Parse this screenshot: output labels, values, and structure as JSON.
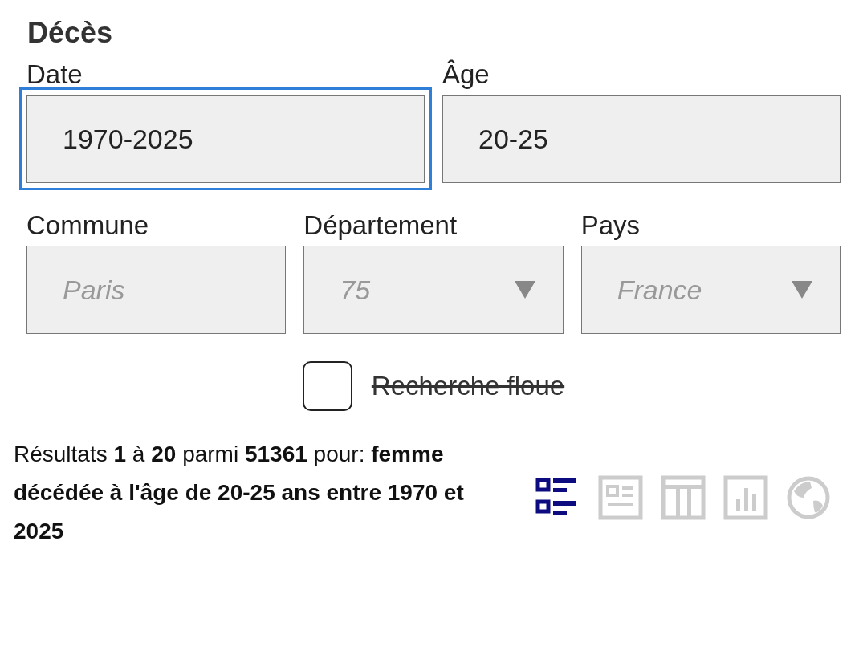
{
  "section": {
    "title": "Décès"
  },
  "rows": [
    [
      {
        "label": "Date",
        "kind": "text",
        "value": "1970-2025",
        "focused": true
      },
      {
        "label": "Âge",
        "kind": "text",
        "value": "20-25",
        "focused": false
      }
    ],
    [
      {
        "label": "Commune",
        "kind": "text",
        "placeholder": "Paris",
        "focused": false
      },
      {
        "label": "Département",
        "kind": "select",
        "placeholder": "75",
        "focused": false
      },
      {
        "label": "Pays",
        "kind": "select",
        "placeholder": "France",
        "focused": false
      }
    ]
  ],
  "fuzzy": {
    "label": "Recherche floue",
    "checked": false
  },
  "summary": "Résultats **1** à **20** parmi **51361** pour: **femme décédée à l'âge de 20-25 ans entre 1970 et 2025**",
  "views": [
    {
      "kind": "list",
      "selected": true
    },
    {
      "kind": "card",
      "selected": false
    },
    {
      "kind": "table",
      "selected": false
    },
    {
      "kind": "chart",
      "selected": false
    },
    {
      "kind": "map",
      "selected": false
    }
  ]
}
